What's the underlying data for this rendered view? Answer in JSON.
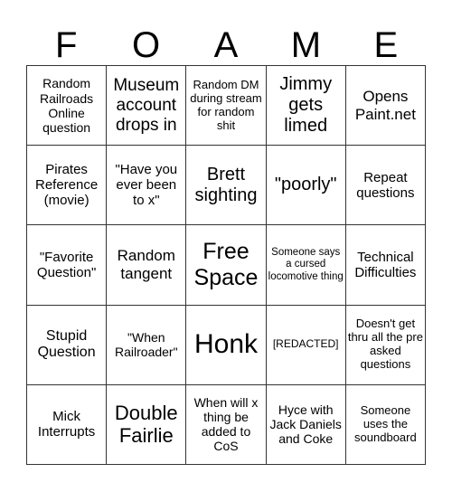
{
  "header": {
    "letters": [
      "F",
      "O",
      "A",
      "M",
      "E"
    ]
  },
  "board": {
    "cells": [
      "Random Railroads Online question",
      "Museum account drops in",
      "Random DM during stream for random shit",
      "Jimmy gets limed",
      "Opens Paint.net",
      "Pirates Reference (movie)",
      "\"Have you ever been to x\"",
      "Brett sighting",
      "\"poorly\"",
      "Repeat questions",
      "\"Favorite Question\"",
      "Random tangent",
      "Free Space",
      "Someone says a cursed locomotive thing",
      "Technical Difficulties",
      "Stupid Question",
      "\"When Railroader\"",
      "Honk",
      "[REDACTED]",
      "Doesn't get thru all the pre asked questions",
      "Mick Interrupts",
      "Double Fairlie",
      "When will x thing be added to CoS",
      "Hyce with Jack Daniels and Coke",
      "Someone uses the soundboard"
    ]
  }
}
